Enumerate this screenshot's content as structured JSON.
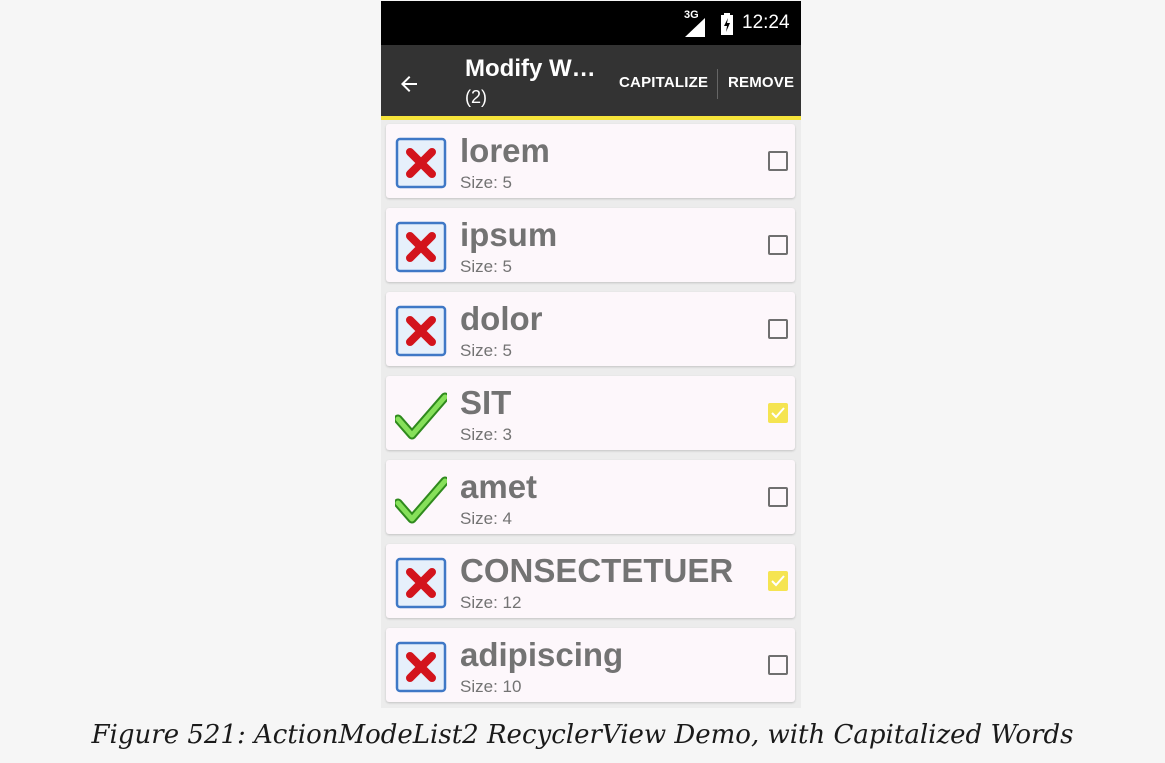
{
  "status_bar": {
    "network": "3G",
    "time": "12:24"
  },
  "action_bar": {
    "title": "Modify W…",
    "subtitle": "(2)",
    "capitalize_label": "CAPITALIZE",
    "remove_label": "REMOVE",
    "accent_color": "#f6e43a"
  },
  "items": [
    {
      "word": "lorem",
      "size": "Size: 5",
      "icon": "red-x-icon",
      "checked": false
    },
    {
      "word": "ipsum",
      "size": "Size: 5",
      "icon": "red-x-icon",
      "checked": false
    },
    {
      "word": "dolor",
      "size": "Size: 5",
      "icon": "red-x-icon",
      "checked": false
    },
    {
      "word": "SIT",
      "size": "Size: 3",
      "icon": "green-check-icon",
      "checked": true
    },
    {
      "word": "amet",
      "size": "Size: 4",
      "icon": "green-check-icon",
      "checked": false
    },
    {
      "word": "CONSECTETUER",
      "size": "Size: 12",
      "icon": "red-x-icon",
      "checked": true
    },
    {
      "word": "adipiscing",
      "size": "Size: 10",
      "icon": "red-x-icon",
      "checked": false
    }
  ],
  "caption": "Figure 521: ActionModeList2 RecyclerView Demo, with Capitalized Words"
}
